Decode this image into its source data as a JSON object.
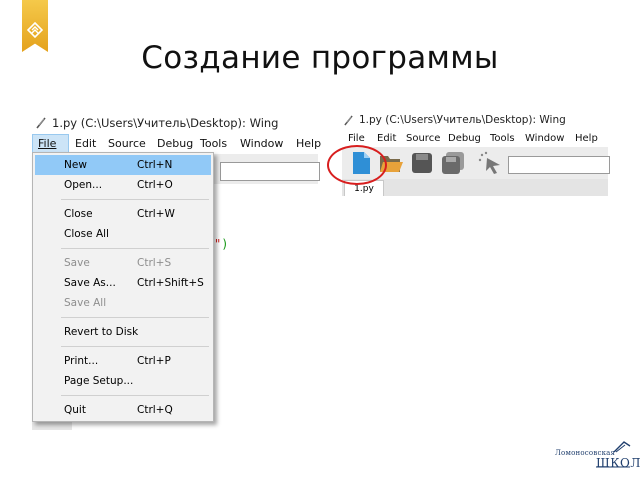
{
  "slide": {
    "title": "Создание программы",
    "logo": {
      "line1": "Ломоносовская",
      "line2": "ШКОЛА"
    }
  },
  "left_window": {
    "title": "1.py (C:\\Users\\Учитель\\Desktop): Wing",
    "menu": [
      "File",
      "Edit",
      "Source",
      "Debug",
      "Tools",
      "Window",
      "Help"
    ],
    "code_fragment": {
      "quote": "\"",
      "paren": ")"
    },
    "file_menu": [
      {
        "label": "New",
        "shortcut": "Ctrl+N",
        "highlighted": true,
        "disabled": false
      },
      {
        "label": "Open...",
        "shortcut": "Ctrl+O",
        "highlighted": false,
        "disabled": false
      },
      {
        "label": "Close",
        "shortcut": "Ctrl+W",
        "highlighted": false,
        "disabled": false
      },
      {
        "label": "Close All",
        "shortcut": "",
        "highlighted": false,
        "disabled": false
      },
      {
        "label": "Save",
        "shortcut": "Ctrl+S",
        "highlighted": false,
        "disabled": true
      },
      {
        "label": "Save As...",
        "shortcut": "Ctrl+Shift+S",
        "highlighted": false,
        "disabled": false
      },
      {
        "label": "Save All",
        "shortcut": "",
        "highlighted": false,
        "disabled": true
      },
      {
        "label": "Revert to Disk",
        "shortcut": "",
        "highlighted": false,
        "disabled": false
      },
      {
        "label": "Print...",
        "shortcut": "Ctrl+P",
        "highlighted": false,
        "disabled": false
      },
      {
        "label": "Page Setup...",
        "shortcut": "",
        "highlighted": false,
        "disabled": false
      },
      {
        "label": "Quit",
        "shortcut": "Ctrl+Q",
        "highlighted": false,
        "disabled": false
      }
    ]
  },
  "right_window": {
    "title": "1.py (C:\\Users\\Учитель\\Desktop): Wing",
    "menu": [
      "File",
      "Edit",
      "Source",
      "Debug",
      "Tools",
      "Window",
      "Help"
    ],
    "toolbar_icons": [
      "new-file-icon",
      "open-folder-icon",
      "save-icon",
      "save-all-icon",
      "pointer-icon"
    ],
    "tab": "1.py"
  },
  "colors": {
    "menu_highlight": "#91c9f7",
    "circle": "#d81e1e",
    "ribbon": "#e4a21d",
    "logo": "#1f3e6d"
  }
}
